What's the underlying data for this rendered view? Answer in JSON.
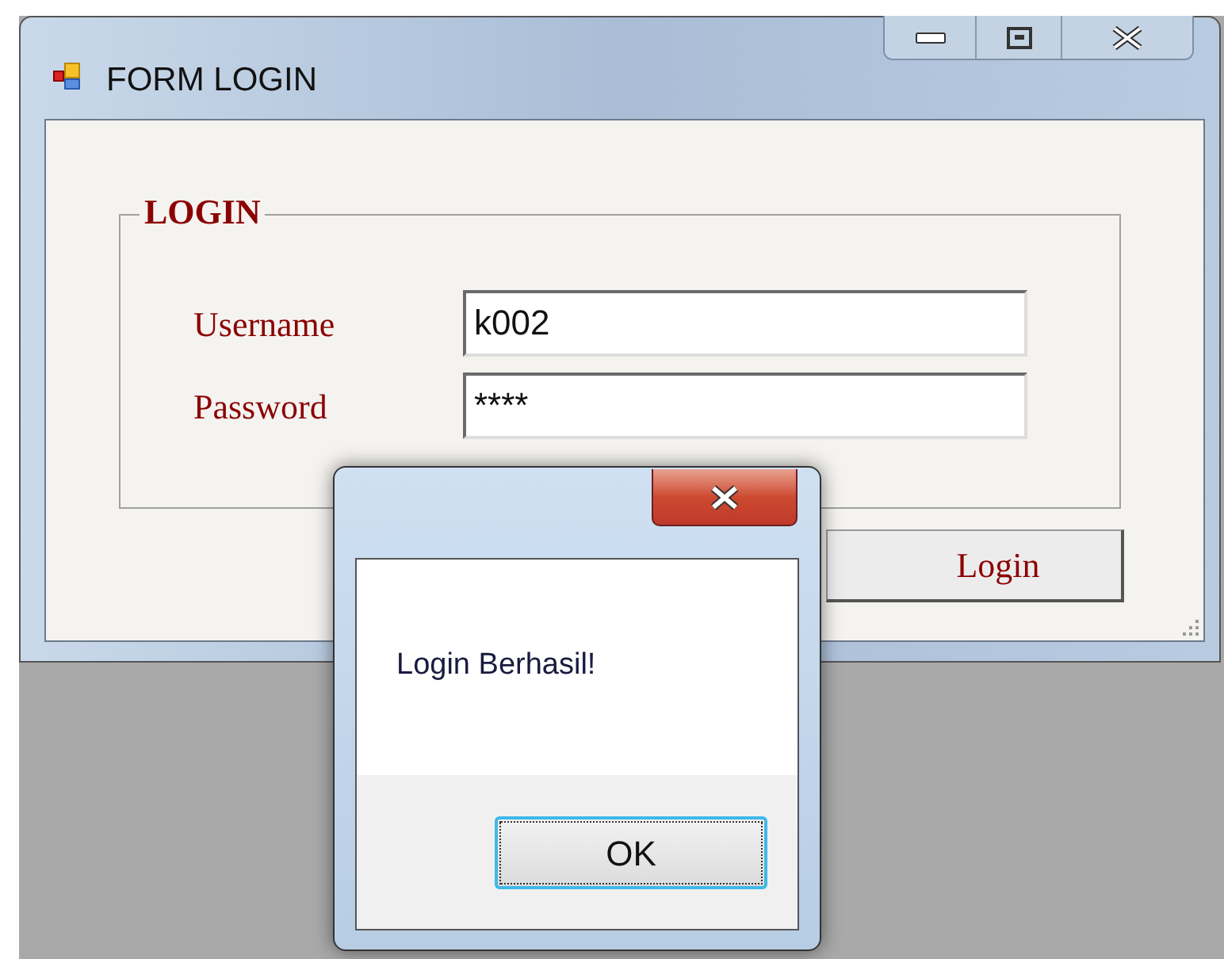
{
  "main_window": {
    "title": "FORM LOGIN",
    "group": {
      "title": "LOGIN",
      "fields": [
        {
          "label": "Username",
          "value": "k002"
        },
        {
          "label": "Password",
          "value": "****"
        }
      ]
    },
    "button": "Login"
  },
  "dialog": {
    "message": "Login Berhasil!",
    "button": "OK",
    "button_focused": true
  }
}
